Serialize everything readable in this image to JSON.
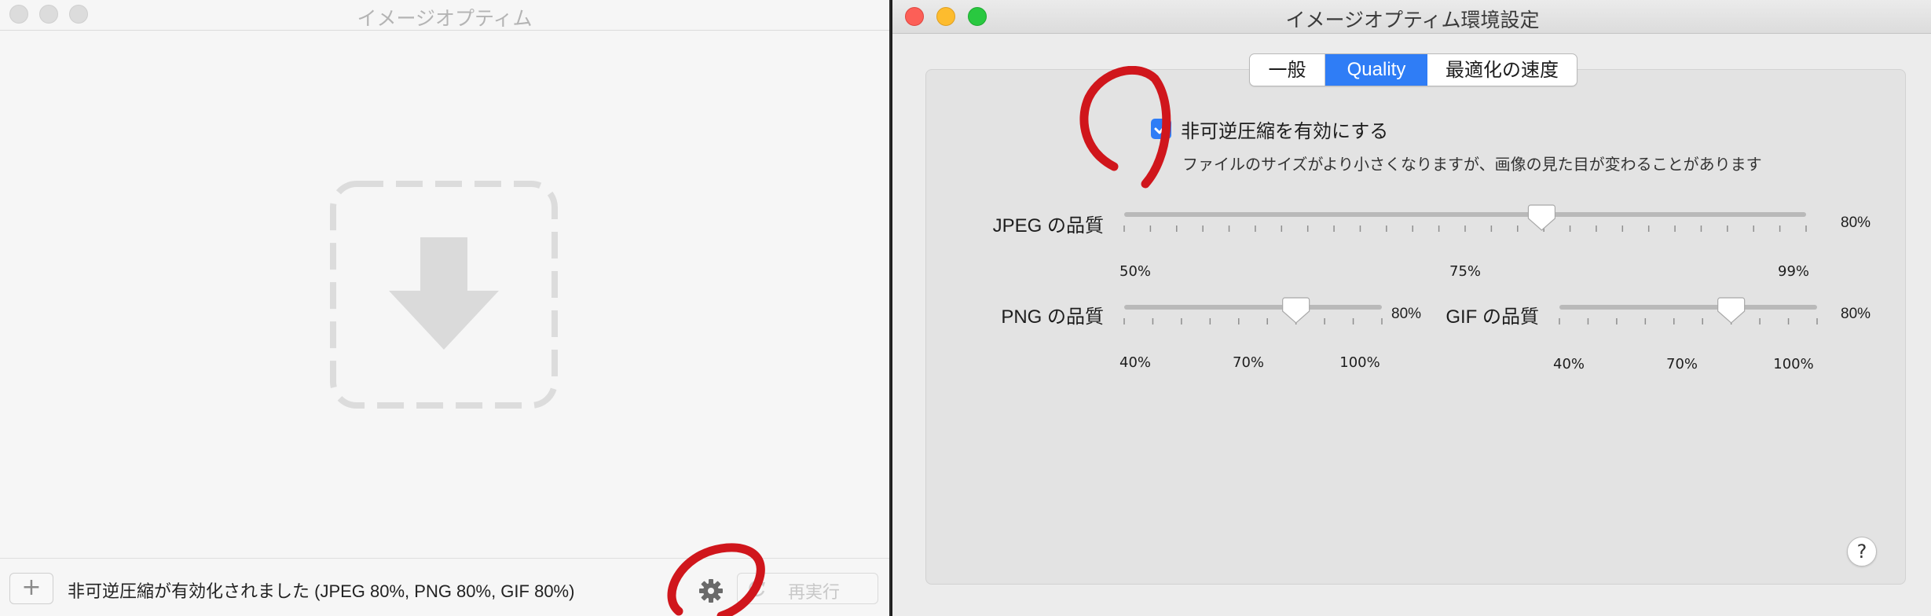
{
  "left_window": {
    "title": "イメージオプティム",
    "drop_icon": "download-arrow-icon",
    "add_button_label": "+",
    "status": "非可逆圧縮が有効化されました (JPEG 80%, PNG 80%, GIF 80%)",
    "rerun_label": "再実行",
    "rerun_disabled": true
  },
  "right_window": {
    "title": "イメージオプティム環境設定",
    "tabs": [
      {
        "label": "一般",
        "active": false
      },
      {
        "label": "Quality",
        "active": true
      },
      {
        "label": "最適化の速度",
        "active": false
      }
    ],
    "lossy": {
      "checked": true,
      "label": "非可逆圧縮を有効にする",
      "description": "ファイルのサイズがより小さくなりますが、画像の見た目が変わることがあります"
    },
    "jpeg": {
      "label": "JPEG の品質",
      "value_text": "80%",
      "min": 50,
      "max": 99,
      "value": 80,
      "tick_labels": [
        "50%",
        "75%",
        "99%"
      ]
    },
    "png": {
      "label": "PNG の品質",
      "value_text": "80%",
      "min": 40,
      "max": 100,
      "value": 80,
      "tick_labels": [
        "40%",
        "70%",
        "100%"
      ]
    },
    "gif": {
      "label": "GIF の品質",
      "value_text": "80%",
      "min": 40,
      "max": 100,
      "value": 80,
      "tick_labels": [
        "40%",
        "70%",
        "100%"
      ]
    },
    "help_label": "?"
  },
  "colors": {
    "accent": "#2f7df6",
    "annotation": "#d0161c"
  }
}
